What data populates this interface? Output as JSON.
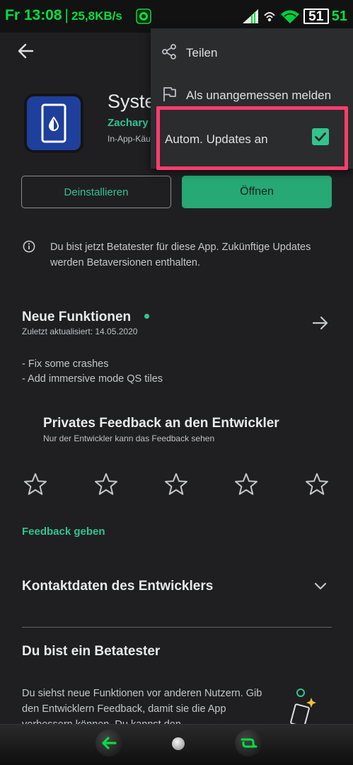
{
  "status_bar": {
    "day_time": "Fr 13:08",
    "separator": "|",
    "net_speed": "25,8KB/s",
    "battery_display": "51",
    "battery_percent": "51",
    "accent_color": "#00e040"
  },
  "header": {
    "back_icon": "arrow-left-icon"
  },
  "app": {
    "title": "Syste",
    "developer": "Zachary",
    "in_app": "In-App-Käu",
    "icon_color": "#1e3f9c"
  },
  "actions": {
    "uninstall_label": "Deinstallieren",
    "open_label": "Öffnen"
  },
  "beta_notice": {
    "text": "Du bist jetzt Betatester für diese App. Zukünftige Updates werden Betaversionen enthalten."
  },
  "whats_new": {
    "title": "Neue Funktionen",
    "updated": "Zuletzt aktualisiert: 14.05.2020",
    "notes": [
      "- Fix some crashes",
      "- Add immersive mode QS tiles"
    ]
  },
  "feedback": {
    "title": "Privates Feedback an den Entwickler",
    "subtitle": "Nur der Entwickler kann das Feedback sehen",
    "stars": [
      "star-1",
      "star-2",
      "star-3",
      "star-4",
      "star-5"
    ],
    "rating": 0,
    "link": "Feedback geben"
  },
  "contact": {
    "title": "Kontaktdaten des Entwicklers"
  },
  "tester": {
    "title": "Du bist ein Betatester",
    "body": "Du siehst neue Funktionen vor anderen Nutzern. Gib den Entwicklern Feedback, damit sie die App verbessern können. Du kannst den"
  },
  "menu": {
    "share_label": "Teilen",
    "report_label": "Als unangemessen melden",
    "auto_update_label": "Autom. Updates an",
    "auto_update_checked": true,
    "accent": "#34c38f",
    "highlight_color": "#ff3d6d"
  }
}
